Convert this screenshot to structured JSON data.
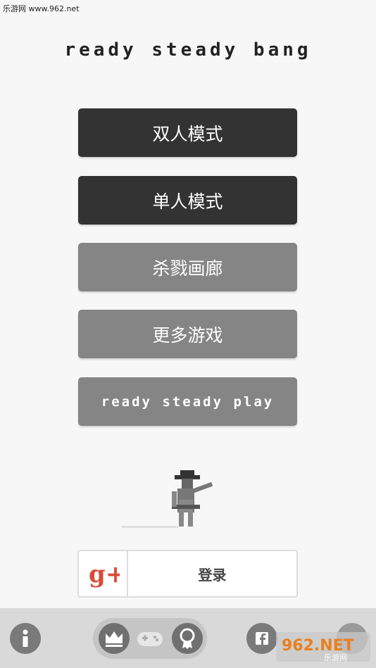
{
  "watermark_top": "乐游网 www.962.net",
  "title": "ready steady bang",
  "menu": {
    "two_player": "双人模式",
    "single_player": "单人模式",
    "kill_gallery": "杀戮画廊",
    "more_games": "更多游戏",
    "ready_steady_play": "ready steady play"
  },
  "login": {
    "google_plus": "g+",
    "label": "登录"
  },
  "bottom_bar": {
    "icons": [
      "info-icon",
      "crown-icon",
      "gamepad-icon",
      "award-icon",
      "facebook-icon",
      "share-icon"
    ]
  },
  "watermark_br": {
    "brand": "962.NET",
    "sub": "乐游网"
  },
  "colors": {
    "dark_button": "#333333",
    "gray_button": "#858585",
    "background": "#f7f7f7",
    "bottom_bar": "#d9d9d9",
    "google_red": "#d84b37"
  }
}
